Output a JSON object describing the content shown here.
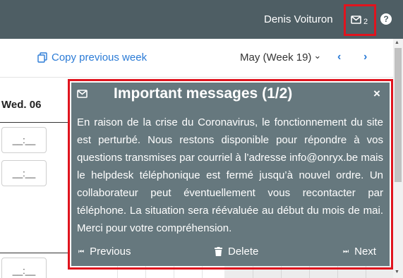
{
  "header": {
    "user_name": "Denis Voituron",
    "message_count": "2",
    "help_icon": "?"
  },
  "toolbar": {
    "copy_label": "Copy previous week",
    "week_label": "May (Week 19)",
    "dropdown_icon": "⌄",
    "prev_icon": "‹",
    "next_icon": "›"
  },
  "calendar": {
    "day_header": "Wed. 06",
    "time_placeholder": "__:__"
  },
  "message": {
    "title": "Important messages (1/2)",
    "close_icon": "×",
    "body": "En raison de la crise du Coronavirus, le fonctionnement du site est perturbé. Nous restons disponible pour répondre à vos questions transmises par courriel à l’adresse info@onryx.be mais le helpdesk téléphonique est fermé jusqu’à nouvel ordre. Un collaborateur peut éventuellement vous recontacter par téléphone. La situation sera réévaluée au début du mois de mai. Merci pour votre compréhension.",
    "previous_label": "Previous",
    "delete_label": "Delete",
    "next_label": "Next"
  },
  "colors": {
    "header_bg": "#4e5e64",
    "panel_bg": "#66787e",
    "accent_blue": "#2b7bd6",
    "highlight_red": "#e0141e"
  }
}
